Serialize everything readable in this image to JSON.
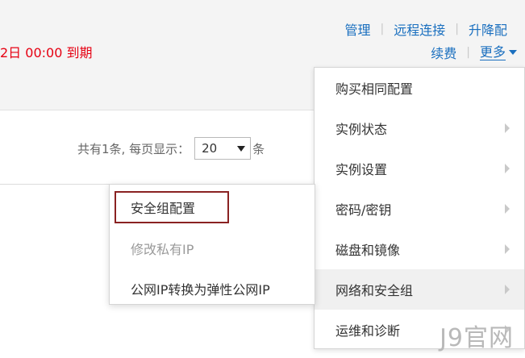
{
  "header": {
    "expire_text": "2日 00:00 到期",
    "actions_row1": [
      "管理",
      "远程连接",
      "升降配"
    ],
    "separator": "|",
    "renew_label": "续费",
    "more_label": "更多"
  },
  "pager": {
    "total_text": "共有1条, 每页显示：",
    "page_size": "20",
    "suffix": "条"
  },
  "dropdown": {
    "items": [
      {
        "label": "购买相同配置",
        "has_submenu": false
      },
      {
        "label": "实例状态",
        "has_submenu": true
      },
      {
        "label": "实例设置",
        "has_submenu": true
      },
      {
        "label": "密码/密钥",
        "has_submenu": true
      },
      {
        "label": "磁盘和镜像",
        "has_submenu": true
      },
      {
        "label": "网络和安全组",
        "has_submenu": true,
        "active": true
      },
      {
        "label": "运维和诊断",
        "has_submenu": true
      }
    ]
  },
  "submenu": {
    "items": [
      {
        "label": "安全组配置",
        "highlighted": true
      },
      {
        "label": "修改私有IP",
        "disabled": true
      },
      {
        "label": "公网IP转换为弹性公网IP"
      }
    ]
  },
  "watermark": "J9官网",
  "colors": {
    "link": "#1a6fbf",
    "expire": "#e60012",
    "highlight_border": "#8a2222"
  }
}
